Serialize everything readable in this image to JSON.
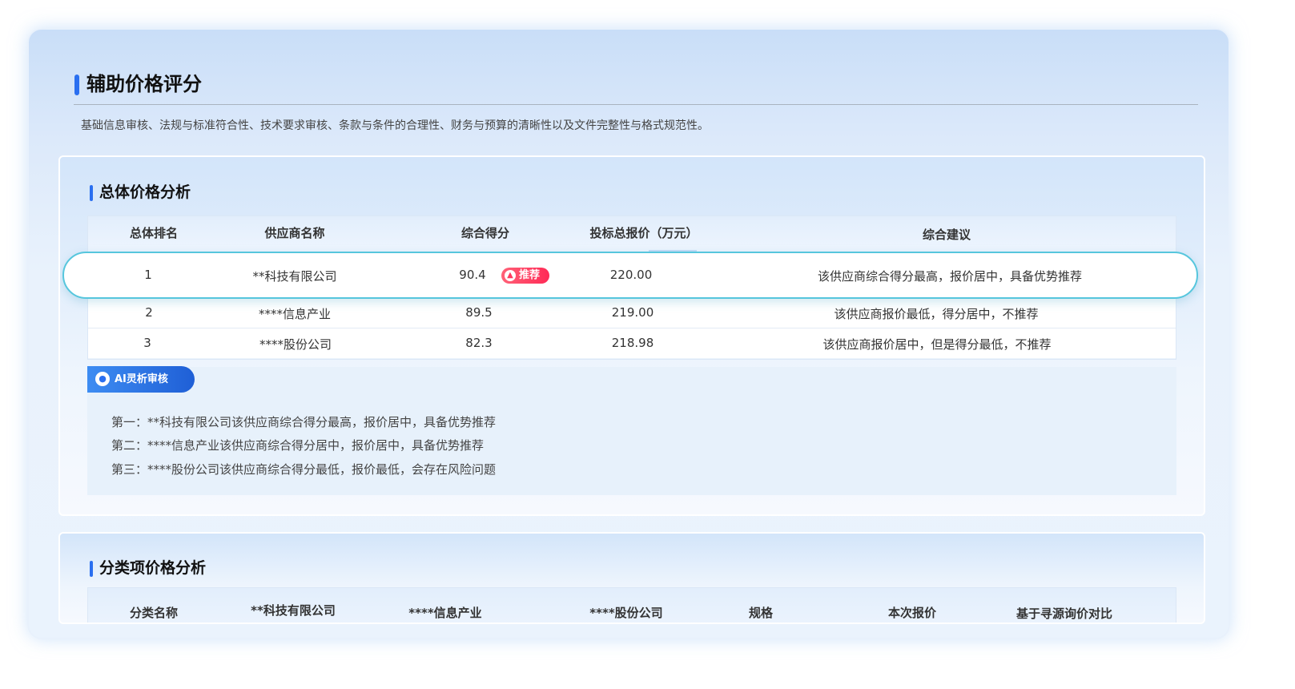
{
  "page": {
    "title": "辅助价格评分",
    "description": "基础信息审核、法规与标准符合性、技术要求审核、条款与条件的合理性、财务与预算的清晰性以及文件完整性与格式规范性。"
  },
  "overall": {
    "section_title": "总体价格分析",
    "headers": [
      "总体排名",
      "供应商名称",
      "综合得分",
      "投标总报价（万元）",
      "综合建议"
    ],
    "rows": [
      {
        "rank": "1",
        "supplier": "**科技有限公司",
        "score": "90.4",
        "price": "220.00",
        "advice": "该供应商综合得分最高，报价居中，具备优势推荐",
        "badge": "推荐"
      },
      {
        "rank": "2",
        "supplier": "****信息产业",
        "score": "89.5",
        "price": "219.00",
        "advice": "该供应商报价最低，得分居中，不推荐"
      },
      {
        "rank": "3",
        "supplier": "****股份公司",
        "score": "82.3",
        "price": "218.98",
        "advice": "该供应商报价居中，但是得分最低，不推荐"
      }
    ],
    "ai_label": "AI灵析审核",
    "ai_lines": [
      "第一：**科技有限公司该供应商综合得分最高，报价居中，具备优势推荐",
      "第二：****信息产业该供应商综合得分居中，报价居中，具备优势推荐",
      "第三：****股份公司该供应商综合得分最低，报价最低，会存在风险问题"
    ]
  },
  "category": {
    "section_title": "分类项价格分析",
    "headers": [
      "分类名称",
      "**科技有限公司",
      "****信息产业",
      "****股份公司",
      "规格",
      "本次报价",
      "基于寻源询价对比"
    ]
  },
  "colors": {
    "accent": "#2a6ff0",
    "recommend_badge": "#ff3a5e",
    "highlight_border": "#56c6dd"
  },
  "icons": {
    "recommend": "thumbs-up-icon",
    "ai": "ai-robot-icon"
  }
}
